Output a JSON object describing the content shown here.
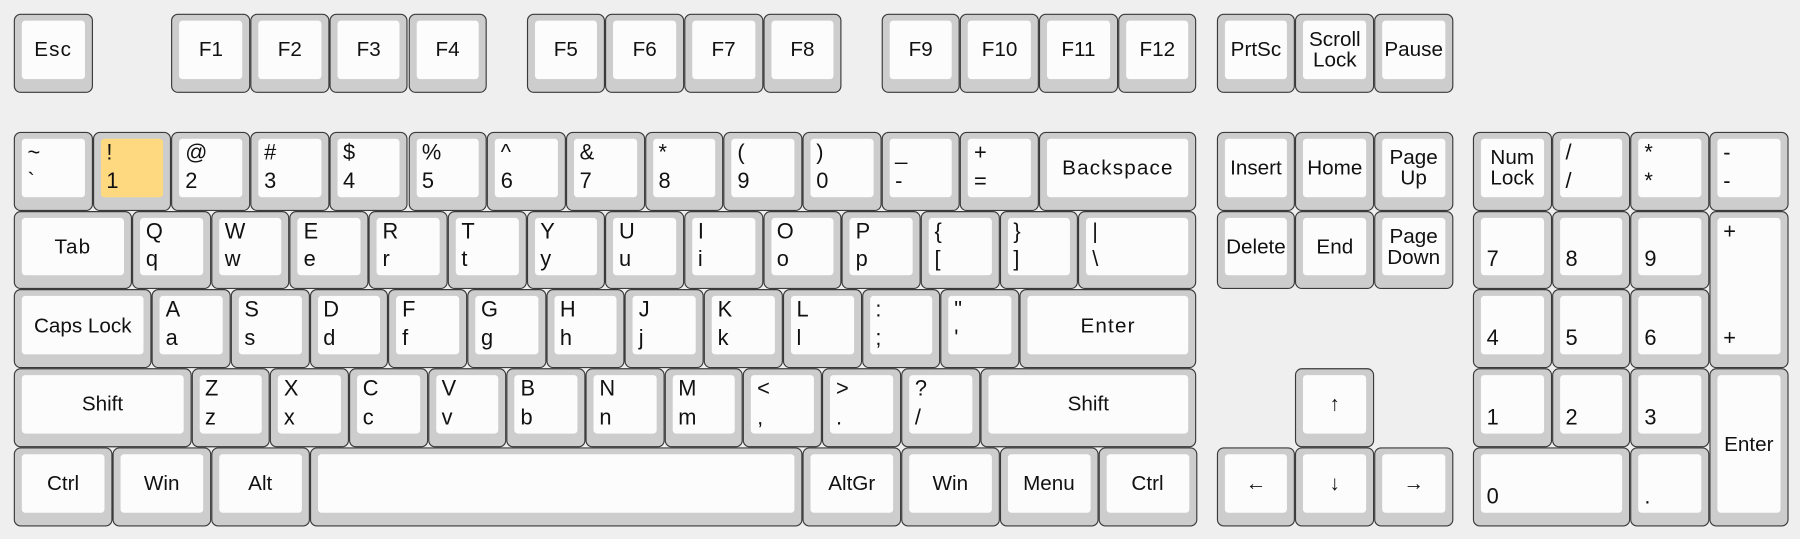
{
  "highlighted_key": "one",
  "colors": {
    "background": "#efefef",
    "key_frame": "#cdcdcd",
    "keycap": "#fcfcfc",
    "highlight": "#ffd97f",
    "border": "#3a3a3a"
  },
  "rows": {
    "function_row": [
      {
        "id": "esc",
        "label": "Esc"
      },
      {
        "id": "f1",
        "label": "F1"
      },
      {
        "id": "f2",
        "label": "F2"
      },
      {
        "id": "f3",
        "label": "F3"
      },
      {
        "id": "f4",
        "label": "F4"
      },
      {
        "id": "f5",
        "label": "F5"
      },
      {
        "id": "f6",
        "label": "F6"
      },
      {
        "id": "f7",
        "label": "F7"
      },
      {
        "id": "f8",
        "label": "F8"
      },
      {
        "id": "f9",
        "label": "F9"
      },
      {
        "id": "f10",
        "label": "F10"
      },
      {
        "id": "f11",
        "label": "F11"
      },
      {
        "id": "f12",
        "label": "F12"
      },
      {
        "id": "prtsc",
        "label": "PrtSc"
      },
      {
        "id": "scroll-lock",
        "label": "Scroll\nLock"
      },
      {
        "id": "pause",
        "label": "Pause"
      }
    ],
    "number_row": [
      {
        "id": "backtick",
        "top": "~",
        "bottom": "`"
      },
      {
        "id": "one",
        "top": "!",
        "bottom": "1"
      },
      {
        "id": "two",
        "top": "@",
        "bottom": "2"
      },
      {
        "id": "three",
        "top": "#",
        "bottom": "3"
      },
      {
        "id": "four",
        "top": "$",
        "bottom": "4"
      },
      {
        "id": "five",
        "top": "%",
        "bottom": "5"
      },
      {
        "id": "six",
        "top": "^",
        "bottom": "6"
      },
      {
        "id": "seven",
        "top": "&",
        "bottom": "7"
      },
      {
        "id": "eight",
        "top": "*",
        "bottom": "8"
      },
      {
        "id": "nine",
        "top": "(",
        "bottom": "9"
      },
      {
        "id": "zero",
        "top": ")",
        "bottom": "0"
      },
      {
        "id": "minus",
        "top": "_",
        "bottom": "-"
      },
      {
        "id": "equals",
        "top": "+",
        "bottom": "="
      },
      {
        "id": "backspace",
        "label": "Backspace"
      },
      {
        "id": "insert",
        "label": "Insert"
      },
      {
        "id": "home",
        "label": "Home"
      },
      {
        "id": "page-up",
        "label": "Page\nUp"
      },
      {
        "id": "num-lock",
        "label": "Num\nLock"
      },
      {
        "id": "np-divide",
        "top": "/",
        "bottom": "/"
      },
      {
        "id": "np-multiply",
        "top": "*",
        "bottom": "*"
      },
      {
        "id": "np-minus",
        "top": "-",
        "bottom": "-"
      }
    ],
    "qwerty_row": [
      {
        "id": "tab",
        "label": "Tab"
      },
      {
        "id": "q",
        "top": "Q",
        "bottom": "q"
      },
      {
        "id": "w",
        "top": "W",
        "bottom": "w"
      },
      {
        "id": "e",
        "top": "E",
        "bottom": "e"
      },
      {
        "id": "r",
        "top": "R",
        "bottom": "r"
      },
      {
        "id": "t",
        "top": "T",
        "bottom": "t"
      },
      {
        "id": "y",
        "top": "Y",
        "bottom": "y"
      },
      {
        "id": "u",
        "top": "U",
        "bottom": "u"
      },
      {
        "id": "i",
        "top": "I",
        "bottom": "i"
      },
      {
        "id": "o",
        "top": "O",
        "bottom": "o"
      },
      {
        "id": "p",
        "top": "P",
        "bottom": "p"
      },
      {
        "id": "lbracket",
        "top": "{",
        "bottom": "["
      },
      {
        "id": "rbracket",
        "top": "}",
        "bottom": "]"
      },
      {
        "id": "backslash",
        "top": "|",
        "bottom": "\\"
      },
      {
        "id": "delete",
        "label": "Delete"
      },
      {
        "id": "end",
        "label": "End"
      },
      {
        "id": "page-down",
        "label": "Page\nDown"
      },
      {
        "id": "np-7",
        "bottom": "7"
      },
      {
        "id": "np-8",
        "bottom": "8"
      },
      {
        "id": "np-9",
        "bottom": "9"
      },
      {
        "id": "np-plus",
        "top": "+",
        "bottom": "+"
      }
    ],
    "home_row": [
      {
        "id": "caps-lock",
        "label": "Caps Lock"
      },
      {
        "id": "a",
        "top": "A",
        "bottom": "a"
      },
      {
        "id": "s",
        "top": "S",
        "bottom": "s"
      },
      {
        "id": "d",
        "top": "D",
        "bottom": "d"
      },
      {
        "id": "f",
        "top": "F",
        "bottom": "f"
      },
      {
        "id": "g",
        "top": "G",
        "bottom": "g"
      },
      {
        "id": "h",
        "top": "H",
        "bottom": "h"
      },
      {
        "id": "j",
        "top": "J",
        "bottom": "j"
      },
      {
        "id": "k",
        "top": "K",
        "bottom": "k"
      },
      {
        "id": "l",
        "top": "L",
        "bottom": "l"
      },
      {
        "id": "semicolon",
        "top": ":",
        "bottom": ";"
      },
      {
        "id": "quote",
        "top": "\"",
        "bottom": "'"
      },
      {
        "id": "enter",
        "label": "Enter"
      },
      {
        "id": "np-4",
        "bottom": "4"
      },
      {
        "id": "np-5",
        "bottom": "5"
      },
      {
        "id": "np-6",
        "bottom": "6"
      }
    ],
    "shift_row": [
      {
        "id": "left-shift",
        "label": "Shift"
      },
      {
        "id": "z",
        "top": "Z",
        "bottom": "z"
      },
      {
        "id": "x",
        "top": "X",
        "bottom": "x"
      },
      {
        "id": "c",
        "top": "C",
        "bottom": "c"
      },
      {
        "id": "v",
        "top": "V",
        "bottom": "v"
      },
      {
        "id": "b",
        "top": "B",
        "bottom": "b"
      },
      {
        "id": "n",
        "top": "N",
        "bottom": "n"
      },
      {
        "id": "m",
        "top": "M",
        "bottom": "m"
      },
      {
        "id": "comma",
        "top": "<",
        "bottom": ","
      },
      {
        "id": "period",
        "top": ">",
        "bottom": "."
      },
      {
        "id": "slash",
        "top": "?",
        "bottom": "/"
      },
      {
        "id": "right-shift",
        "label": "Shift"
      },
      {
        "id": "arrow-up",
        "label": "↑"
      },
      {
        "id": "np-1",
        "bottom": "1"
      },
      {
        "id": "np-2",
        "bottom": "2"
      },
      {
        "id": "np-3",
        "bottom": "3"
      },
      {
        "id": "np-enter",
        "label": "Enter"
      }
    ],
    "bottom_row": [
      {
        "id": "left-ctrl",
        "label": "Ctrl"
      },
      {
        "id": "left-win",
        "label": "Win"
      },
      {
        "id": "alt",
        "label": "Alt"
      },
      {
        "id": "space",
        "label": ""
      },
      {
        "id": "altgr",
        "label": "AltGr"
      },
      {
        "id": "right-win",
        "label": "Win"
      },
      {
        "id": "menu",
        "label": "Menu"
      },
      {
        "id": "right-ctrl",
        "label": "Ctrl"
      },
      {
        "id": "arrow-left",
        "label": "←"
      },
      {
        "id": "arrow-down",
        "label": "↓"
      },
      {
        "id": "arrow-right",
        "label": "→"
      },
      {
        "id": "np-0",
        "bottom": "0"
      },
      {
        "id": "np-decimal",
        "bottom": "."
      }
    ]
  }
}
